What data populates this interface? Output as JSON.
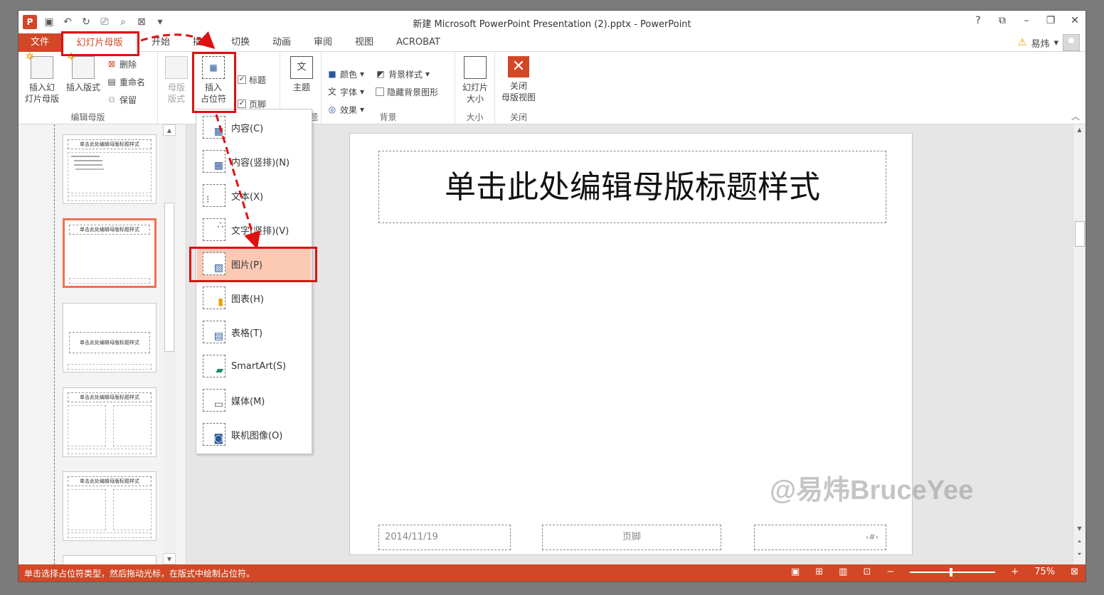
{
  "window": {
    "title": "新建 Microsoft PowerPoint Presentation (2).pptx - PowerPoint",
    "controls": [
      "?",
      "⧉",
      "–",
      "❐",
      "✕"
    ]
  },
  "qat": {
    "logo": "P"
  },
  "tabs": [
    "文件",
    "幻灯片母版",
    "开始",
    "插入",
    "切换",
    "动画",
    "审阅",
    "视图",
    "ACROBAT"
  ],
  "user": {
    "name": "易炜"
  },
  "ribbon": {
    "edit_master": {
      "label": "编辑母版",
      "insert_slide_master": "插入幻\n灯片母版",
      "insert_layout": "插入版式",
      "delete": "删除",
      "rename": "重命名",
      "preserve": "保留"
    },
    "master_layout": {
      "master_layout": "母版\n版式",
      "insert_placeholder": "插入\n占位符",
      "title": "标题",
      "footer": "页脚"
    },
    "theme": {
      "label": "题",
      "theme": "主题"
    },
    "background": {
      "label": "背景",
      "colors": "颜色",
      "fonts": "字体",
      "effects": "效果",
      "bg_styles": "背景样式",
      "hide_bg": "隐藏背景图形"
    },
    "size": {
      "label": "大小",
      "slide_size": "幻灯片\n大小"
    },
    "close": {
      "label": "关闭",
      "close_master": "关闭\n母版视图"
    }
  },
  "dropdown": [
    {
      "label": "内容(C)",
      "icon": "content-icon"
    },
    {
      "label": "内容(竖排)(N)",
      "icon": "content-vertical-icon"
    },
    {
      "label": "文本(X)",
      "icon": "text-icon"
    },
    {
      "label": "文字(竖排)(V)",
      "icon": "text-vertical-icon"
    },
    {
      "label": "图片(P)",
      "icon": "picture-icon"
    },
    {
      "label": "图表(H)",
      "icon": "chart-icon"
    },
    {
      "label": "表格(T)",
      "icon": "table-icon"
    },
    {
      "label": "SmartArt(S)",
      "icon": "smartart-icon"
    },
    {
      "label": "媒体(M)",
      "icon": "media-icon"
    },
    {
      "label": "联机图像(O)",
      "icon": "online-image-icon"
    }
  ],
  "thumbnails": {
    "master_title": "单击此处编辑母版标题样式",
    "section_title": "单击此处编辑母版标题样式"
  },
  "slide": {
    "title": "单击此处编辑母版标题样式",
    "date": "2014/11/19",
    "footer": "页脚",
    "number": "‹#›"
  },
  "watermark": "@易炜BruceYee",
  "status": {
    "hint": "单击选择占位符类型，然后拖动光标，在版式中绘制占位符。",
    "zoom": "75%"
  },
  "colors": {
    "accent": "#d24726",
    "highlight": "#fcc9b5",
    "annotation": "#e01010"
  }
}
